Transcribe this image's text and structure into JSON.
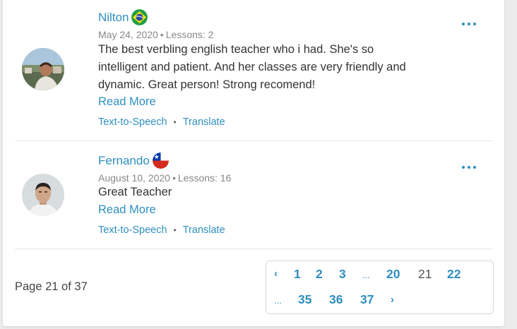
{
  "reviews": [
    {
      "name": "Nilton",
      "flag": "brazil-flag",
      "date": "May 24, 2020",
      "lessons": "Lessons: 2",
      "text": "The best verbling english teacher who i had. She's so intelligent and patient. And her classes are very friendly and dynamic. Great person! Strong recomend!",
      "read_more": "Read More",
      "tts": "Text-to-Speech",
      "translate": "Translate"
    },
    {
      "name": "Fernando",
      "flag": "chile-flag",
      "date": "August 10, 2020",
      "lessons": "Lessons: 16",
      "text": "Great Teacher",
      "read_more": "Read More",
      "tts": "Text-to-Speech",
      "translate": "Translate"
    }
  ],
  "separator_dot": "•",
  "pagination": {
    "label": "Page 21 of 37",
    "prev": "‹",
    "next": "›",
    "ellipsis": "...",
    "pages": [
      "1",
      "2",
      "3",
      "20",
      "21",
      "22",
      "35",
      "36",
      "37"
    ],
    "current": "21"
  },
  "colors": {
    "link": "#2e8fbf",
    "text": "#333333",
    "meta": "#888888"
  }
}
